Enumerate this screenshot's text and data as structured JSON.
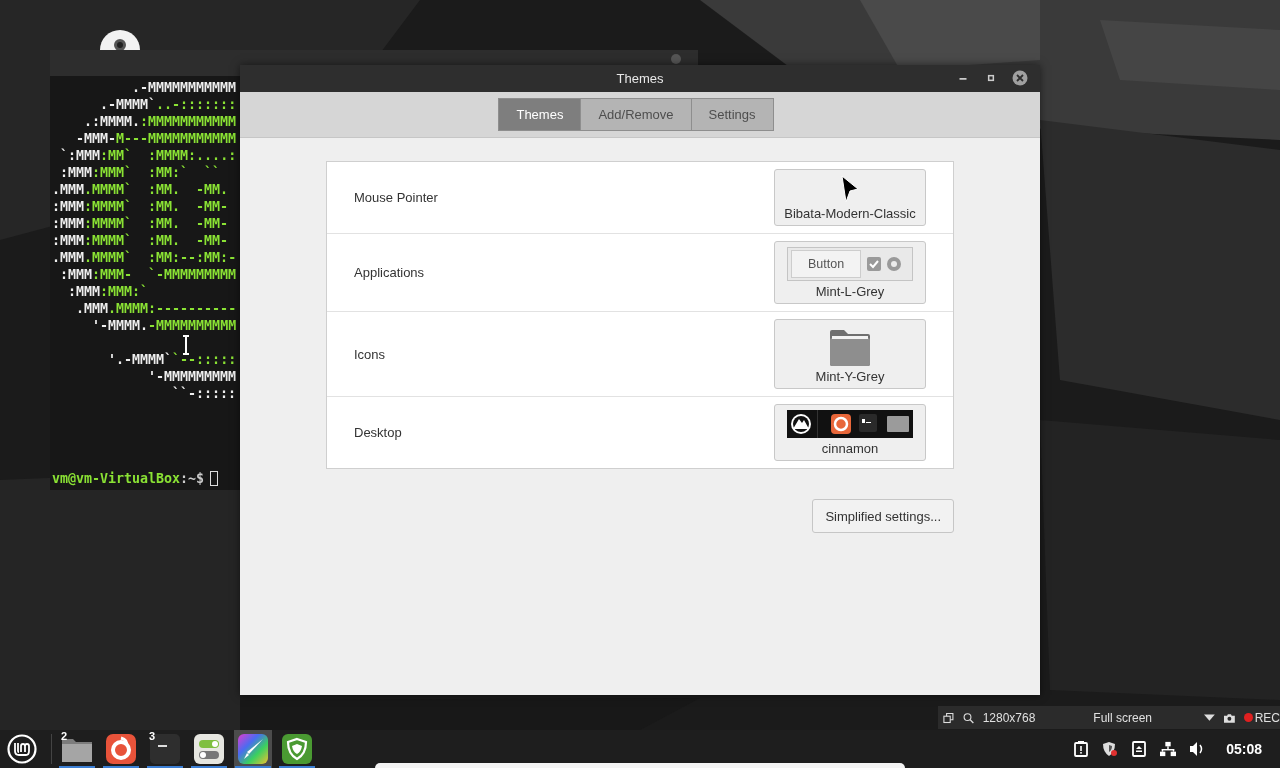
{
  "terminal": {
    "blocks": [
      {
        "lines": [
          {
            "segments": [
              {
                "text": "          .-MMMMMMMMMMM",
                "color": "#eeeeee"
              }
            ]
          },
          {
            "segments": [
              {
                "text": "      .-MMMM`",
                "color": "#eeeeee"
              },
              {
                "text": "..-:::::::",
                "color": "#8ae234"
              }
            ]
          },
          {
            "segments": [
              {
                "text": "    .:MMMM.",
                "color": "#eeeeee"
              },
              {
                "text": ":MMMMMMMMMMM",
                "color": "#8ae234"
              }
            ]
          },
          {
            "segments": [
              {
                "text": "   -MMM-",
                "color": "#eeeeee"
              },
              {
                "text": "M---MMMMMMMMMMM",
                "color": "#8ae234"
              }
            ]
          },
          {
            "segments": [
              {
                "text": " `:MMM",
                "color": "#eeeeee"
              },
              {
                "text": ":MM`  :MMMM:....:",
                "color": "#8ae234"
              }
            ]
          },
          {
            "segments": [
              {
                "text": " :MMM",
                "color": "#eeeeee"
              },
              {
                "text": ":MMM`  :MM:`  ``",
                "color": "#8ae234"
              }
            ]
          },
          {
            "segments": [
              {
                "text": ".MMM",
                "color": "#eeeeee"
              },
              {
                "text": ".MMMM`  :MM.  -MM.",
                "color": "#8ae234"
              }
            ]
          },
          {
            "segments": [
              {
                "text": ":MMM",
                "color": "#eeeeee"
              },
              {
                "text": ":MMMM`  :MM.  -MM-",
                "color": "#8ae234"
              }
            ]
          },
          {
            "segments": [
              {
                "text": ":MMM",
                "color": "#eeeeee"
              },
              {
                "text": ":MMMM`  :MM.  -MM-",
                "color": "#8ae234"
              }
            ]
          },
          {
            "segments": [
              {
                "text": ":MMM",
                "color": "#eeeeee"
              },
              {
                "text": ":MMMM`  :MM.  -MM-",
                "color": "#8ae234"
              }
            ]
          },
          {
            "segments": [
              {
                "text": ".MMM",
                "color": "#eeeeee"
              },
              {
                "text": ".MMMM`  :MM:--:MM:-",
                "color": "#8ae234"
              }
            ]
          },
          {
            "segments": [
              {
                "text": " :MMM",
                "color": "#eeeeee"
              },
              {
                "text": ":MMM-  `-MMMMMMMMM",
                "color": "#8ae234"
              }
            ]
          },
          {
            "segments": [
              {
                "text": "  :MMM",
                "color": "#eeeeee"
              },
              {
                "text": ":MMM:`",
                "color": "#8ae234"
              }
            ]
          },
          {
            "segments": [
              {
                "text": "   .MMM",
                "color": "#eeeeee"
              },
              {
                "text": ".MMMM:----------",
                "color": "#8ae234"
              }
            ]
          },
          {
            "segments": [
              {
                "text": "     '-MMMM.",
                "color": "#eeeeee"
              },
              {
                "text": "-MMMMMMMMMM",
                "color": "#8ae234"
              }
            ]
          }
        ]
      },
      {
        "lines": [
          {
            "segments": [
              {
                "text": "       '.-MMMM`",
                "color": "#eeeeee"
              },
              {
                "text": "`--:::::",
                "color": "#8ae234"
              }
            ]
          },
          {
            "segments": [
              {
                "text": "            '-MMMMMMMMM",
                "color": "#eeeeee"
              }
            ]
          },
          {
            "segments": [
              {
                "text": "               ``-:::::",
                "color": "#eeeeee"
              }
            ]
          }
        ]
      }
    ],
    "prompt": [
      {
        "text": "vm@vm-VirtualBox",
        "color": "#8ae234"
      },
      {
        "text": ":~$",
        "color": "#cccccc"
      }
    ]
  },
  "themes_window": {
    "title": "Themes",
    "tabs": [
      {
        "label": "Themes",
        "selected": true
      },
      {
        "label": "Add/Remove",
        "selected": false
      },
      {
        "label": "Settings",
        "selected": false
      }
    ],
    "rows": [
      {
        "label": "Mouse Pointer",
        "kind": "pointer",
        "value": "Bibata-Modern-Classic"
      },
      {
        "label": "Applications",
        "kind": "applications",
        "value": "Mint-L-Grey",
        "preview_label": "Button"
      },
      {
        "label": "Icons",
        "kind": "icons",
        "value": "Mint-Y-Grey"
      },
      {
        "label": "Desktop",
        "kind": "desktop",
        "value": "cinnamon"
      }
    ],
    "simplified_button": "Simplified settings..."
  },
  "recorder_bar": {
    "resolution": "1280x768",
    "mode": "Full screen",
    "rec": "REC"
  },
  "taskbar": {
    "items": [
      {
        "kind": "folder",
        "badge": "2",
        "selected": false
      },
      {
        "kind": "browser",
        "selected": false
      },
      {
        "kind": "terminal",
        "badge": "3",
        "selected": false
      },
      {
        "kind": "toggles",
        "selected": false
      },
      {
        "kind": "paint",
        "selected": true
      },
      {
        "kind": "shield",
        "selected": false
      }
    ],
    "clock": "05:08"
  }
}
